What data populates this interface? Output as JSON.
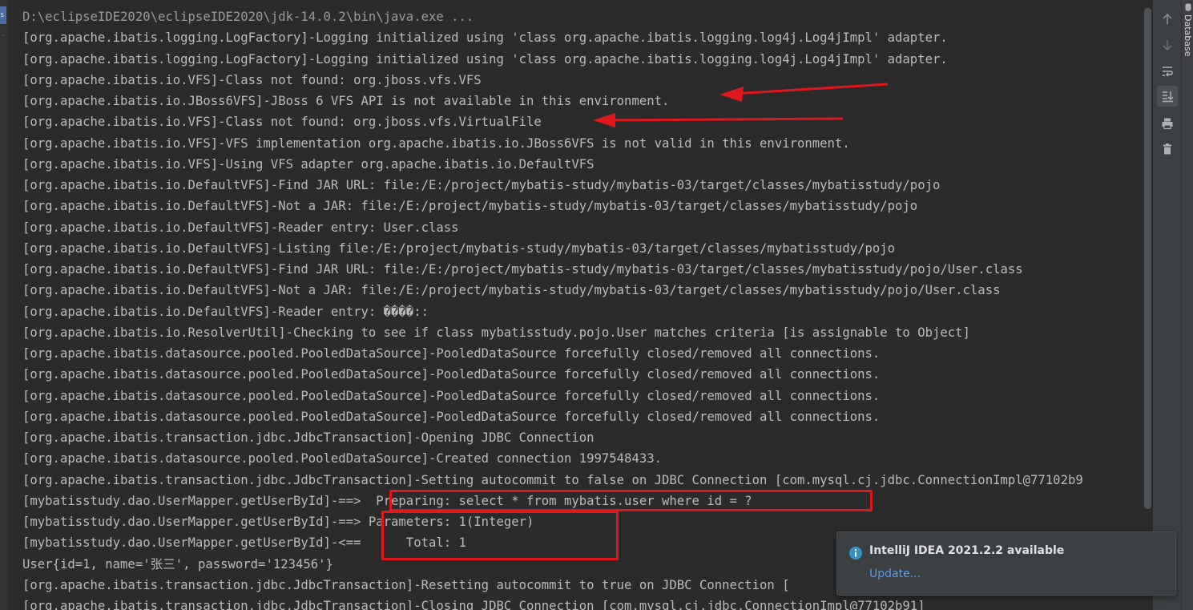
{
  "left_tab": {
    "label": "s"
  },
  "console": {
    "lines": [
      "D:\\eclipseIDE2020\\eclipseIDE2020\\jdk-14.0.2\\bin\\java.exe ...",
      "[org.apache.ibatis.logging.LogFactory]-Logging initialized using 'class org.apache.ibatis.logging.log4j.Log4jImpl' adapter.",
      "[org.apache.ibatis.logging.LogFactory]-Logging initialized using 'class org.apache.ibatis.logging.log4j.Log4jImpl' adapter.",
      "[org.apache.ibatis.io.VFS]-Class not found: org.jboss.vfs.VFS",
      "[org.apache.ibatis.io.JBoss6VFS]-JBoss 6 VFS API is not available in this environment.",
      "[org.apache.ibatis.io.VFS]-Class not found: org.jboss.vfs.VirtualFile",
      "[org.apache.ibatis.io.VFS]-VFS implementation org.apache.ibatis.io.JBoss6VFS is not valid in this environment.",
      "[org.apache.ibatis.io.VFS]-Using VFS adapter org.apache.ibatis.io.DefaultVFS",
      "[org.apache.ibatis.io.DefaultVFS]-Find JAR URL: file:/E:/project/mybatis-study/mybatis-03/target/classes/mybatisstudy/pojo",
      "[org.apache.ibatis.io.DefaultVFS]-Not a JAR: file:/E:/project/mybatis-study/mybatis-03/target/classes/mybatisstudy/pojo",
      "[org.apache.ibatis.io.DefaultVFS]-Reader entry: User.class",
      "[org.apache.ibatis.io.DefaultVFS]-Listing file:/E:/project/mybatis-study/mybatis-03/target/classes/mybatisstudy/pojo",
      "[org.apache.ibatis.io.DefaultVFS]-Find JAR URL: file:/E:/project/mybatis-study/mybatis-03/target/classes/mybatisstudy/pojo/User.class",
      "[org.apache.ibatis.io.DefaultVFS]-Not a JAR: file:/E:/project/mybatis-study/mybatis-03/target/classes/mybatisstudy/pojo/User.class",
      "[org.apache.ibatis.io.DefaultVFS]-Reader entry: ����::",
      "[org.apache.ibatis.io.ResolverUtil]-Checking to see if class mybatisstudy.pojo.User matches criteria [is assignable to Object]",
      "[org.apache.ibatis.datasource.pooled.PooledDataSource]-PooledDataSource forcefully closed/removed all connections.",
      "[org.apache.ibatis.datasource.pooled.PooledDataSource]-PooledDataSource forcefully closed/removed all connections.",
      "[org.apache.ibatis.datasource.pooled.PooledDataSource]-PooledDataSource forcefully closed/removed all connections.",
      "[org.apache.ibatis.datasource.pooled.PooledDataSource]-PooledDataSource forcefully closed/removed all connections.",
      "[org.apache.ibatis.transaction.jdbc.JdbcTransaction]-Opening JDBC Connection",
      "[org.apache.ibatis.datasource.pooled.PooledDataSource]-Created connection 1997548433.",
      "[org.apache.ibatis.transaction.jdbc.JdbcTransaction]-Setting autocommit to false on JDBC Connection [com.mysql.cj.jdbc.ConnectionImpl@77102b9",
      "[mybatisstudy.dao.UserMapper.getUserById]-==>  Preparing: select * from mybatis.user where id = ?",
      "[mybatisstudy.dao.UserMapper.getUserById]-==> Parameters: 1(Integer)",
      "[mybatisstudy.dao.UserMapper.getUserById]-<==      Total: 1",
      "User{id=1, name='张三', password='123456'}",
      "[org.apache.ibatis.transaction.jdbc.JdbcTransaction]-Resetting autocommit to true on JDBC Connection [",
      "[org.apache.ibatis.transaction.jdbc.JdbcTransaction]-Closing JDBC Connection [com.mysql.cj.jdbc.ConnectionImpl@77102b91]"
    ]
  },
  "toolbar": {
    "buttons": [
      {
        "name": "up-arrow-icon",
        "active": false
      },
      {
        "name": "down-arrow-icon",
        "active": false
      },
      {
        "name": "soft-wrap-icon",
        "active": false
      },
      {
        "name": "scroll-to-end-icon",
        "active": true
      },
      {
        "name": "print-icon",
        "active": false
      },
      {
        "name": "trash-icon",
        "active": false
      }
    ]
  },
  "right_panel": {
    "label": "Database"
  },
  "notification": {
    "title": "IntelliJ IDEA 2021.2.2 available",
    "link": "Update..."
  },
  "colors": {
    "background": "#2b2b2b",
    "text": "#bbbbbb",
    "annotation_red": "#e0181b",
    "link_blue": "#589df6",
    "info_blue": "#3592c4"
  }
}
